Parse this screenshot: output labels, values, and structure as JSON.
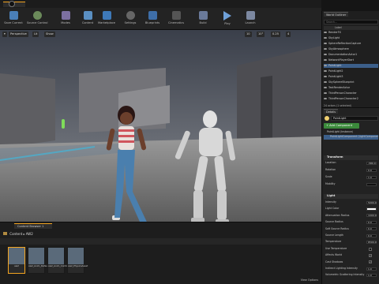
{
  "toolbar": {
    "buttons": [
      {
        "label": "Save Current",
        "icon": "save-icon"
      },
      {
        "label": "Source Control",
        "icon": "source-control-icon"
      },
      {
        "label": "Modes",
        "icon": "modes-icon"
      },
      {
        "label": "Content",
        "icon": "content-icon"
      },
      {
        "label": "Marketplace",
        "icon": "marketplace-icon"
      },
      {
        "label": "Settings",
        "icon": "settings-icon"
      },
      {
        "label": "Blueprints",
        "icon": "blueprints-icon"
      },
      {
        "label": "Cinematics",
        "icon": "cinematics-icon"
      },
      {
        "label": "Build",
        "icon": "build-icon"
      },
      {
        "label": "Play",
        "icon": "play-icon"
      },
      {
        "label": "Launch",
        "icon": "launch-icon"
      }
    ]
  },
  "viewport": {
    "perspective_label": "Perspective",
    "lit_label": "Lit",
    "show_label": "Show",
    "grid_value": "10",
    "angle_value": "10°",
    "scale_value": "0.25",
    "speed_value": "4"
  },
  "outliner": {
    "tab_label": "World Outliner",
    "search_placeholder": "Search...",
    "column_label": "Label",
    "items": [
      {
        "label": "RenderFX",
        "selected": false
      },
      {
        "label": "SkyLight",
        "selected": false
      },
      {
        "label": "SphereReflectionCapture",
        "selected": false
      },
      {
        "label": "SkyAtmosphere",
        "selected": false
      },
      {
        "label": "DocumentationActor1",
        "selected": false
      },
      {
        "label": "NetworkPlayerStart",
        "selected": false
      },
      {
        "label": "PointLight",
        "selected": true
      },
      {
        "label": "PointLight2",
        "selected": false
      },
      {
        "label": "PointLight3",
        "selected": false
      },
      {
        "label": "SkySphereBlueprint",
        "selected": false
      },
      {
        "label": "TextRenderActor",
        "selected": false
      },
      {
        "label": "ThirdPersonCharacter",
        "selected": false
      },
      {
        "label": "ThirdPersonCharacter2",
        "selected": false
      }
    ],
    "count_text": "24 actors (1 selected)"
  },
  "details": {
    "tab_label": "Details",
    "actor_name": "PointLight",
    "add_component_label": "+ Add Component",
    "components": [
      "PointLight (Instance)",
      "PointLightComponent (LightComponent0)"
    ],
    "transform_label": "Transform",
    "transform_props": [
      {
        "label": "Location",
        "value": "-580.0"
      },
      {
        "label": "Rotation",
        "value": "0.0"
      },
      {
        "label": "Scale",
        "value": "1.0"
      },
      {
        "label": "Mobility",
        "value": ""
      }
    ],
    "light_label": "Light",
    "light_props": [
      {
        "label": "Intensity",
        "value": "5000.0",
        "type": "value"
      },
      {
        "label": "Light Color",
        "value": "",
        "type": "color"
      },
      {
        "label": "Attenuation Radius",
        "value": "1000.0",
        "type": "value"
      },
      {
        "label": "Source Radius",
        "value": "0.0",
        "type": "value"
      },
      {
        "label": "Soft Source Radius",
        "value": "0.0",
        "type": "value"
      },
      {
        "label": "Source Length",
        "value": "0.0",
        "type": "value"
      },
      {
        "label": "Temperature",
        "value": "6500.0",
        "type": "value"
      },
      {
        "label": "Use Temperature",
        "value": "",
        "type": "check"
      },
      {
        "label": "Affects World",
        "value": "✓",
        "type": "check"
      },
      {
        "label": "Cast Shadows",
        "value": "✓",
        "type": "check"
      },
      {
        "label": "Indirect Lighting Intensity",
        "value": "1.0",
        "type": "value"
      },
      {
        "label": "Volumetric Scattering Intensity",
        "value": "1.0",
        "type": "value"
      }
    ]
  },
  "content_browser": {
    "tab_label": "Content Browser 1",
    "path": [
      "Content",
      "AW2"
    ],
    "view_options_label": "View Options",
    "assets": [
      {
        "name": "aw2",
        "selected": true
      },
      {
        "name": "aw2_Anim_Default_01",
        "selected": false
      },
      {
        "name": "aw2_Anim_Combined",
        "selected": false
      },
      {
        "name": "aw2_PhysicsAsset",
        "selected": false
      }
    ]
  },
  "colors": {
    "accent": "#f3a420",
    "selection": "#3c5f8a",
    "add_button": "#3b8a3b"
  }
}
